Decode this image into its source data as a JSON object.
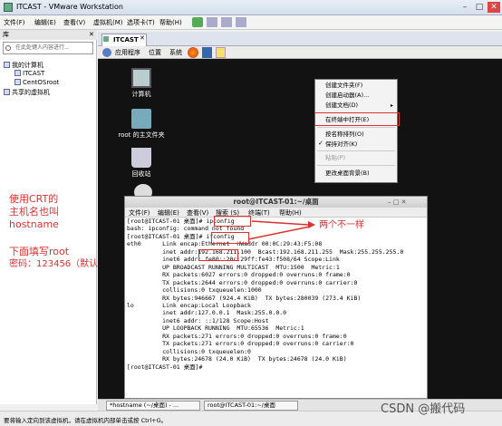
{
  "window": {
    "title": "ITCAST - VMware Workstation"
  },
  "menubar": {
    "items": [
      "文件(F)",
      "编辑(E)",
      "查看(V)",
      "虚拟机(M)",
      "选项卡(T)",
      "帮助(H)"
    ]
  },
  "library": {
    "header": "库",
    "search_placeholder": "在此处键入内容进行...",
    "tree": {
      "root": "我的计算机",
      "vm1": "ITCAST",
      "vm2": "CentOSroot",
      "shared": "共享的虚拟机"
    }
  },
  "annotations": {
    "left1": "使用CRT的",
    "left2": "主机名也叫",
    "left3": "hostname",
    "left4": "下面填写root",
    "left5": "密码：123456（默认）",
    "arrow_label": "两个不一样"
  },
  "vm": {
    "tab": "ITCAST",
    "gnome_menu": [
      "应用程序",
      "位置",
      "系统"
    ]
  },
  "desktop": {
    "icons": [
      "计算机",
      "root 的主文件夹",
      "回收站"
    ]
  },
  "context_menu": {
    "items": [
      "创建文件夹(F)",
      "创建启动器(A)...",
      "创建文档(D)",
      "在终端中打开(E)",
      "按名称排列(O)",
      "保持对齐(K)",
      "粘贴(P)",
      "更改桌面背景(B)"
    ]
  },
  "terminal": {
    "title": "root@ITCAST-01:~/桌面",
    "menu": [
      "文件(F)",
      "编辑(E)",
      "查看(V)",
      "搜索 (S)",
      "终端(T)",
      "帮助(H)"
    ],
    "lines": [
      "[root@ITCAST-01 桌面]# ipconfig",
      "bash: ipconfig: command not found",
      "[root@ITCAST-01 桌面]# ifconfig",
      "eth0      Link encap:Ethernet  HWaddr 00:0C:29:43:F5:08",
      "          inet addr:192.168.211.100  Bcast:192.168.211.255  Mask:255.255.255.0",
      "          inet6 addr: fe80::20c:29ff:fe43:f508/64 Scope:Link",
      "          UP BROADCAST RUNNING MULTICAST  MTU:1500  Metric:1",
      "          RX packets:6027 errors:0 dropped:0 overruns:0 frame:0",
      "          TX packets:2644 errors:0 dropped:0 overruns:0 carrier:0",
      "          collisions:0 txqueuelen:1000",
      "          RX bytes:946667 (924.4 KiB)  TX bytes:280039 (273.4 KiB)",
      "",
      "lo        Link encap:Local Loopback",
      "          inet addr:127.0.0.1  Mask:255.0.0.0",
      "          inet6 addr: ::1/128 Scope:Host",
      "          UP LOOPBACK RUNNING  MTU:65536  Metric:1",
      "          RX packets:271 errors:0 dropped:0 overruns:0 frame:0",
      "          TX packets:271 errors:0 dropped:0 overruns:0 carrier:0",
      "          collisions:0 txqueuelen:0",
      "          RX bytes:24678 (24.0 KiB)  TX bytes:24678 (24.0 KiB)",
      "",
      "[root@ITCAST-01 桌面]# "
    ]
  },
  "taskbar": {
    "items": [
      "*hostname (~/桌面) - ...",
      "root@ITCAST-01:~/桌面"
    ]
  },
  "statusbar": {
    "text": "要将输入定向到该虚拟机，请在虚拟机内部单击或按 Ctrl+G。"
  },
  "watermark": "CSDN @搬代码",
  "colors": {
    "annotation": "#e03030",
    "vm_desktop": "#121212"
  }
}
